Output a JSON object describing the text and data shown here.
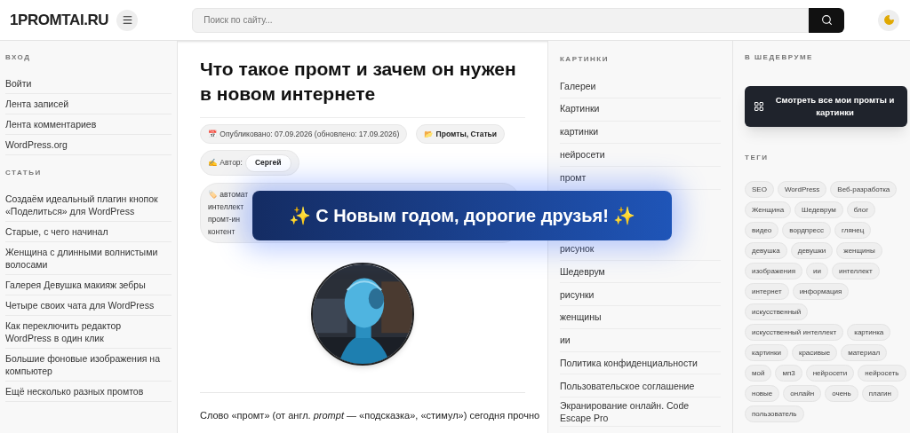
{
  "header": {
    "logo": "1PROMTAI.RU",
    "search": {
      "placeholder": "Поиск по сайту..."
    }
  },
  "left_sidebar": {
    "sections": [
      {
        "heading": "ВХОД",
        "items": [
          "Войти",
          "Лента записей",
          "Лента комментариев",
          "WordPress.org"
        ]
      },
      {
        "heading": "СТАТЬИ",
        "items": [
          "Создаём идеальный плагин кнопок «Поделиться» для WordPress",
          "Старые, с чего начинал",
          "Женщина с длинными волнистыми волосами",
          "Галерея Девушка макияж зебры",
          "Четыре своих чата для WordPress",
          "Как переключить редактор WordPress в один клик",
          "Большие фоновые изображения на компьютер",
          "Ещё несколько разных промтов"
        ]
      }
    ]
  },
  "article": {
    "title": "Что такое промт и зачем он нужен в новом интернете",
    "meta": [
      {
        "kind": "date",
        "text": "📅 Опубликовано: 07.09.2026 (обновлено: 17.09.2026)"
      },
      {
        "kind": "category",
        "text": "📂 Промты, Статьи"
      }
    ],
    "author": {
      "label": "✍️ Автор:",
      "name": "Сергей"
    },
    "tags_lines": [
      "🏷️ автомат",
      "интеллект",
      "промт-ин",
      "контент"
    ],
    "image": {
      "kind": "picture"
    },
    "paragraph": "Слово «промт» (от англ. *prompt* — «подсказка», «стимул») сегодня прочно"
  },
  "banner": "✨ С Новым годом, дорогие друзья! ✨",
  "right_sidebar": {
    "heading": "КАРТИНКИ",
    "items_above": [
      "Галереи",
      "Картинки",
      "картинки",
      "нейросети",
      "промт"
    ],
    "items_below": [
      "рисунок",
      "Шедеврум",
      "рисунки",
      "женщины",
      "ии",
      "Политика конфиденциальности",
      "Пользовательское соглашение",
      "Экранирование онлайн. Code Escape Pro"
    ]
  },
  "far_sidebar": {
    "heading": "В ШЕДЕВРУМЕ",
    "button": "Смотреть все мои промты и картинки",
    "tags_heading": "ТЕГИ",
    "tags": [
      "SEO",
      "WordPress",
      "Веб-разработка",
      "Женщина",
      "Шедеврум",
      "блог",
      "видео",
      "вордпресс",
      "глянец",
      "девушка",
      "девушки",
      "женщины",
      "изображения",
      "ии",
      "интеллект",
      "интернет",
      "информация",
      "искусственный",
      "искусственный интеллект",
      "картинка",
      "картинки",
      "красивые",
      "материал",
      "мой",
      "мп3",
      "нейросети",
      "нейросеть",
      "новые",
      "онлайн",
      "очень",
      "плагин",
      "пользователь"
    ]
  }
}
